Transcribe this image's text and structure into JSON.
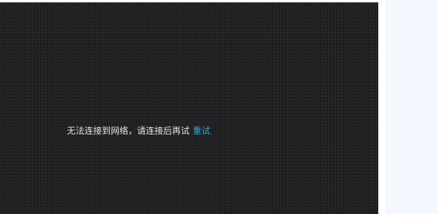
{
  "player": {
    "error_message": "无法连接到网络，请连接后再试",
    "retry_label": "重试"
  },
  "colors": {
    "player_background": "#1f2022",
    "message_text": "#e6e6e6",
    "retry_link": "#2aa7e6",
    "side_panel": "#f3f7fe"
  }
}
